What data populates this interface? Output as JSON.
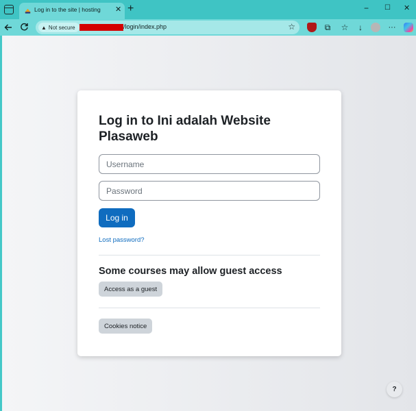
{
  "browser": {
    "tab_title": "Log in to the site | hosting",
    "tab_close": "✕",
    "new_tab": "+",
    "address": {
      "security_label": "Not secure",
      "url_path": "/login/index.php"
    },
    "window_controls": {
      "minimize": "−",
      "maximize": "☐",
      "close": "✕"
    }
  },
  "login": {
    "heading": "Log in to Ini adalah Website Plasaweb",
    "username_placeholder": "Username",
    "password_placeholder": "Password",
    "login_button": "Log in",
    "lost_password": "Lost password?"
  },
  "guest": {
    "heading": "Some courses may allow guest access",
    "access_button": "Access as a guest"
  },
  "cookies_button": "Cookies notice",
  "help_label": "?",
  "colors": {
    "primary": "#0f6cbf",
    "browser_theme": "#45c8c8",
    "secondary_btn": "#ced4da"
  },
  "icons": [
    "sidebar-toggle-icon",
    "site-favicon",
    "back-arrow-icon",
    "refresh-icon",
    "warning-icon",
    "star-icon",
    "ublock-icon",
    "puzzle-icon",
    "favorites-icon",
    "download-icon",
    "profile-avatar",
    "more-icon",
    "copilot-icon",
    "help-icon"
  ]
}
